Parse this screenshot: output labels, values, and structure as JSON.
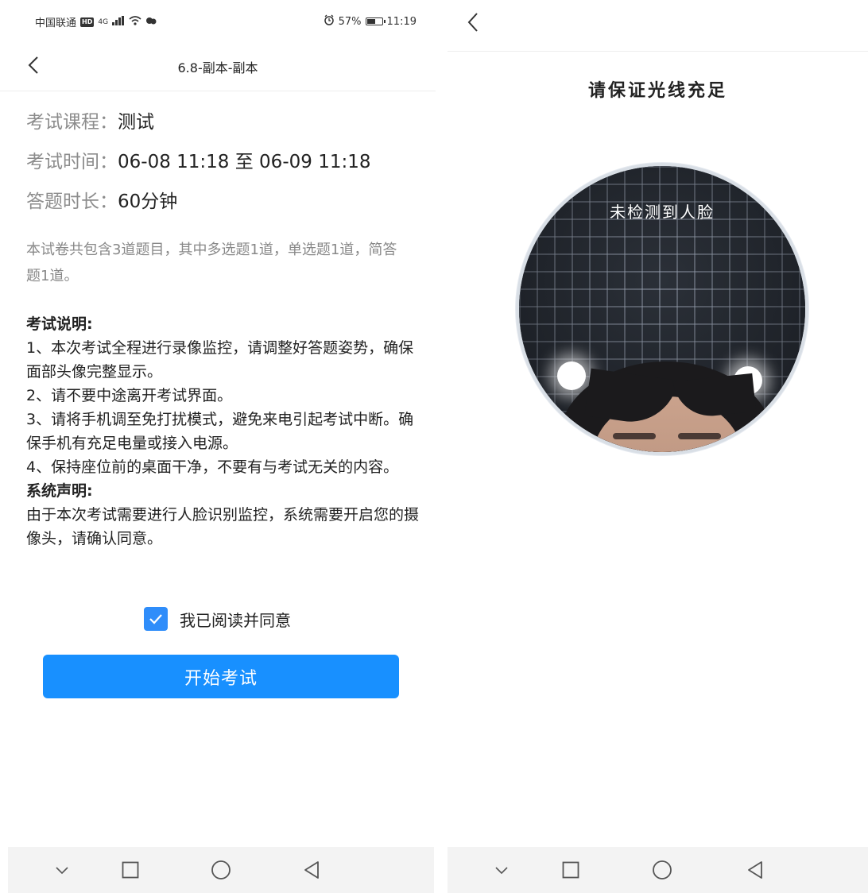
{
  "left_screen": {
    "status_bar": {
      "carrier": "中国联通",
      "hd": "HD",
      "network": "4G",
      "battery_percent_text": "57%",
      "battery_level": 0.57,
      "time": "11:19"
    },
    "nav_title": "6.8-副本-副本",
    "course": {
      "label": "考试课程：",
      "value": "测试"
    },
    "time_range": {
      "label": "考试时间：",
      "value": "06-08 11:18 至 06-09 11:18"
    },
    "duration": {
      "label": "答题时长：",
      "value": "60分钟"
    },
    "summary": "本试卷共包含3道题目，其中多选题1道，单选题1道，简答题1道。",
    "exam_notes_heading": "考试说明:",
    "exam_notes": [
      "1、本次考试全程进行录像监控，请调整好答题姿势，确保面部头像完整显示。",
      "2、请不要中途离开考试界面。",
      "3、请将手机调至免打扰模式，避免来电引起考试中断。确保手机有充足电量或接入电源。",
      "4、保持座位前的桌面干净，不要有与考试无关的内容。"
    ],
    "system_heading": "系统声明:",
    "system_text": "由于本次考试需要进行人脸识别监控，系统需要开启您的摄像头，请确认同意。",
    "agree_label": "我已阅读并同意",
    "agree_checked": true,
    "start_button": "开始考试"
  },
  "right_screen": {
    "prompt": "请保证光线充足",
    "camera_status": "未检测到人脸"
  },
  "colors": {
    "primary": "#1890ff",
    "checkbox": "#2f8dfa",
    "label_gray": "#8c8c8c"
  },
  "icons": [
    "back-icon",
    "checkmark-icon",
    "chevron-down-icon",
    "square-icon",
    "circle-icon",
    "triangle-back-icon"
  ]
}
